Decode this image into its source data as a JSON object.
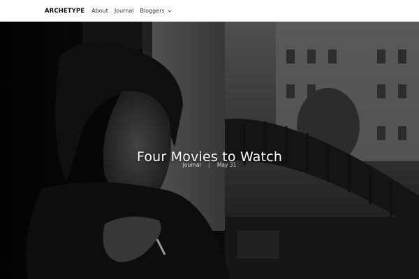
{
  "nav": {
    "brand": "ARCHETYPE",
    "links": [
      {
        "label": "About"
      },
      {
        "label": "Journal"
      },
      {
        "label": "Bloggers",
        "icon": "chevron-down-icon"
      }
    ]
  },
  "hero": {
    "title": "Four Movies to Watch",
    "category": "Journal",
    "separator": "|",
    "date": "May 31"
  },
  "colors": {
    "topbar_bg": "#ffffff",
    "hero_tone": "grayscale"
  }
}
